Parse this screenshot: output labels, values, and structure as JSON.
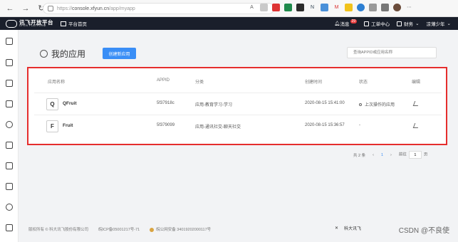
{
  "browser": {
    "url_scheme": "https://",
    "url_host": "console.xfyun.cn",
    "url_path": "/app/myapp",
    "ext_labels": [
      "A",
      "N",
      "M"
    ]
  },
  "topbar": {
    "logo_main": "讯飞开放平台",
    "logo_sub": "OPEN PLATFORM",
    "home": "平台首页",
    "messages": "消息",
    "message_count": "29",
    "workspace": "工单中心",
    "finance": "财务",
    "user": "凉薄少年"
  },
  "page": {
    "title": "我的应用",
    "create_button": "创建新应用",
    "search_placeholder": "查询APPID或应用名称"
  },
  "table": {
    "headers": {
      "name": "应用名称",
      "appid": "APPID",
      "category": "分类",
      "created": "创建时间",
      "status": "状态",
      "edit": "编辑"
    },
    "rows": [
      {
        "icon": "Q",
        "name": "QFruit",
        "appid": "5f37918c",
        "category": "应用-教育学习-学习",
        "created": "2020-08-15 15:41:00",
        "status": "上次操作的应用"
      },
      {
        "icon": "F",
        "name": "Fruit",
        "appid": "5f379099",
        "category": "应用-通讯社交-聊天社交",
        "created": "2020-08-15 15:36:57",
        "status": "-"
      }
    ]
  },
  "pager": {
    "total": "共 2 条",
    "prev": "‹",
    "page": "1",
    "next": "›",
    "goto_label": "前往",
    "goto_value": "1",
    "goto_suffix": "页"
  },
  "footer": {
    "copyright": "版权所有 © 科大讯飞股份有限公司",
    "icp": "皖ICP备05001217号-71",
    "police": "皖公网安备 34019202000117号",
    "brand": "科大讯飞",
    "watermark": "CSDN @不良使"
  },
  "colors": {
    "accent": "#3a8ef6",
    "highlight_border": "#e52d2d",
    "topbar": "#1a1f2b"
  }
}
